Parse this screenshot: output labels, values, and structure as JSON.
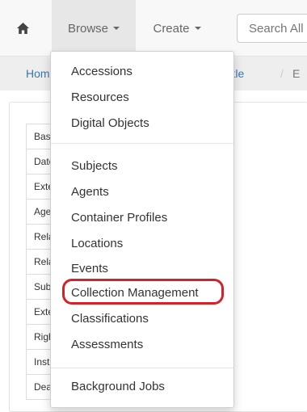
{
  "navbar": {
    "home_icon": "home-icon",
    "browse_label": "Browse",
    "create_label": "Create",
    "search_placeholder": "Search All Records"
  },
  "breadcrumb": {
    "home": "Home",
    "title": "test title",
    "separator": "/",
    "current": "E"
  },
  "side_nav": [
    "Basic Information",
    "Dates",
    "Extents",
    "Agent Links",
    "Related Accessions",
    "Related Resources",
    "Subjects",
    "External Documents",
    "Rights Statements",
    "Instances",
    "Deaccessions"
  ],
  "dropdown": {
    "group1": [
      "Accessions",
      "Resources",
      "Digital Objects"
    ],
    "group2": [
      "Subjects",
      "Agents",
      "Container Profiles",
      "Locations",
      "Events",
      "Collection Management",
      "Classifications",
      "Assessments"
    ],
    "group3": [
      "Background Jobs"
    ],
    "highlighted_item": "Collection Management",
    "highlight_color": "#d2232a"
  }
}
